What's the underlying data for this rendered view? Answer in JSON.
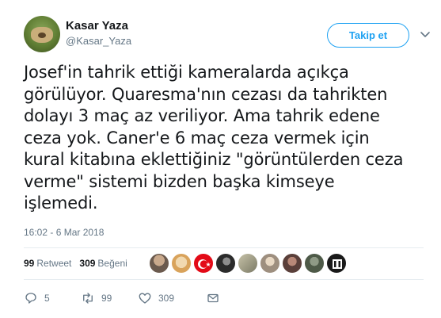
{
  "user": {
    "name": "Kasar Yaza",
    "handle": "@Kasar_Yaza"
  },
  "follow_label": "Takip et",
  "tweet": {
    "lines": [
      "Josef'in tahrik ettiği kameralarda açıkça",
      "görülüyor. Quaresma'nın cezası da tahrikten",
      "dolayı 3 maç az veriliyor. Ama tahrik edene",
      "ceza yok. Caner'e 6 maç ceza vermek için",
      "kural kitabına eklettiğiniz \"görüntülerden ceza",
      "verme\" sistemi bizden başka kimseye",
      "işlemedi."
    ],
    "timestamp": "16:02 - 6 Mar 2018"
  },
  "stats": {
    "retweets": "99",
    "retweets_label": "Retweet",
    "likes": "309",
    "likes_label": "Beğeni"
  },
  "likers": [
    {
      "icon": "avatar-1",
      "color": "#6b5a4e"
    },
    {
      "icon": "avatar-2",
      "color": "#d9a35b"
    },
    {
      "icon": "turkish-flag-avatar",
      "color": "#e30a17"
    },
    {
      "icon": "avatar-4",
      "color": "#2b2b2b"
    },
    {
      "icon": "avatar-5",
      "color": "#9a9a88"
    },
    {
      "icon": "avatar-6",
      "color": "#cfc6b8"
    },
    {
      "icon": "avatar-7",
      "color": "#5a3f3a"
    },
    {
      "icon": "avatar-8",
      "color": "#4e5a48"
    },
    {
      "icon": "besiktas-avatar",
      "color": "#1a1a1a"
    }
  ],
  "actions": {
    "replies": "5",
    "retweets": "99",
    "likes": "309"
  },
  "colors": {
    "accent": "#1da1f2",
    "secondary_text": "#657786",
    "primary_text": "#14171a",
    "divider": "#e6ecf0"
  }
}
